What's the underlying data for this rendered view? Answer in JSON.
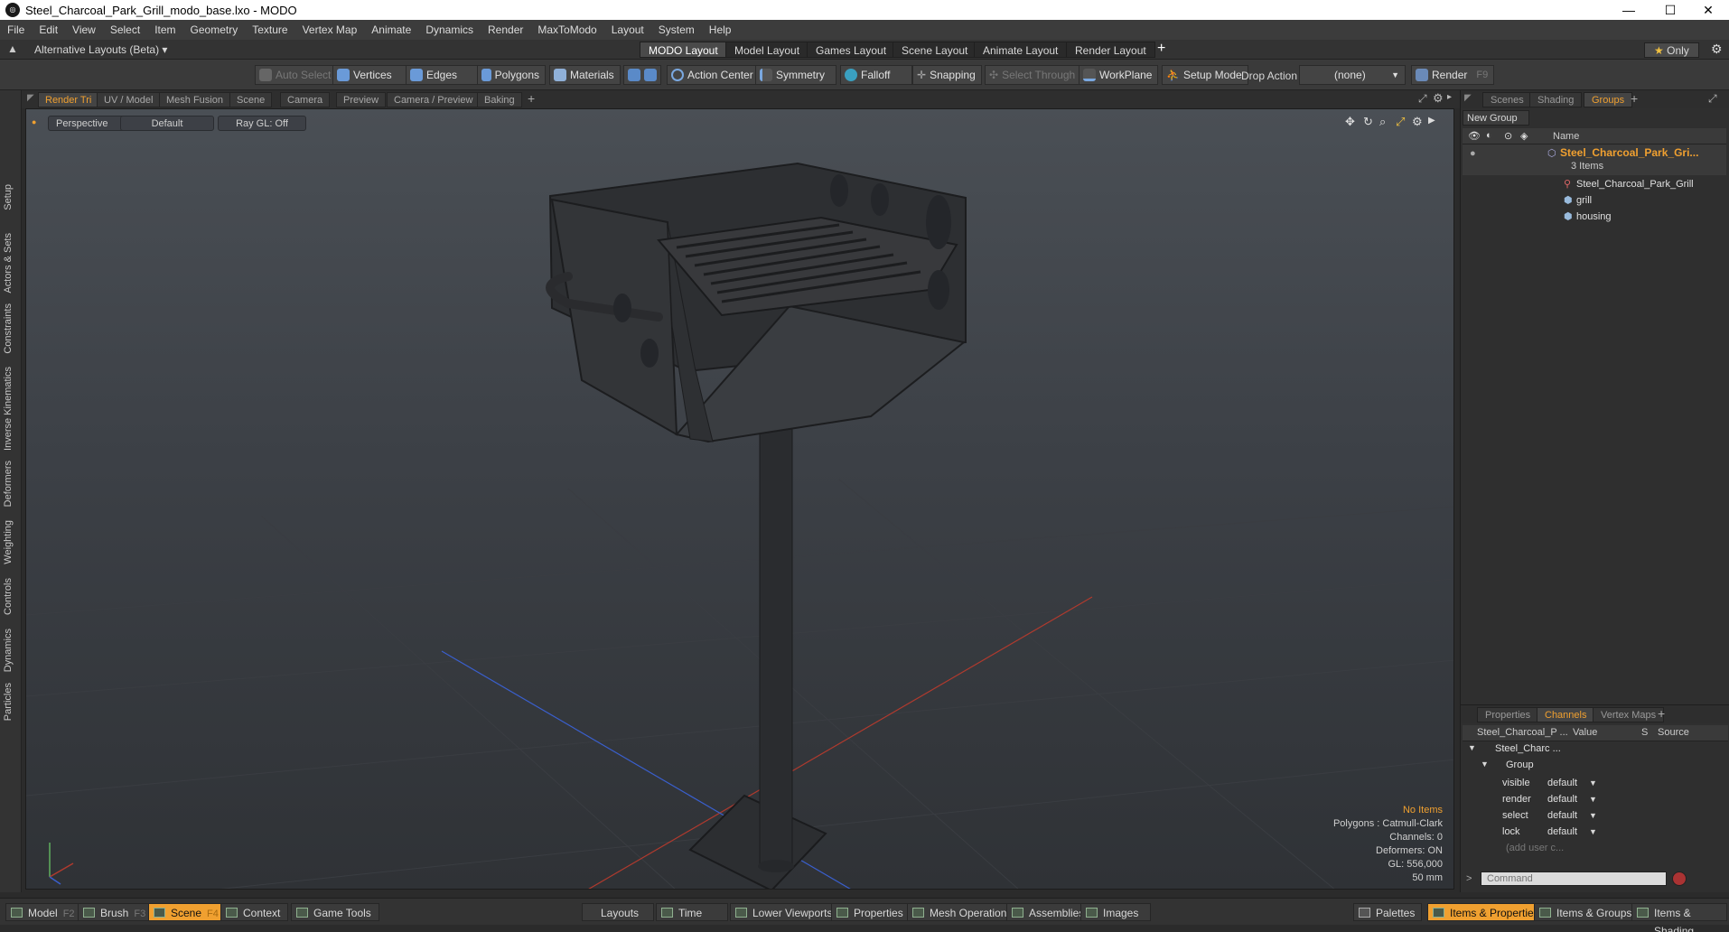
{
  "window": {
    "title": "Steel_Charcoal_Park_Grill_modo_base.lxo - MODO",
    "app_icon": "modo-logo-icon"
  },
  "menu": [
    "File",
    "Edit",
    "View",
    "Select",
    "Item",
    "Geometry",
    "Texture",
    "Vertex Map",
    "Animate",
    "Dynamics",
    "Render",
    "MaxToModo",
    "Layout",
    "System",
    "Help"
  ],
  "layoutbar": {
    "alt_layouts": "Alternative Layouts (Beta)",
    "tabs": [
      "MODO Layout",
      "Model Layout",
      "Games Layout",
      "Scene Layout",
      "Animate Layout",
      "Render Layout"
    ],
    "only_label": "Only"
  },
  "toolbar": {
    "auto_select": "Auto Select",
    "vertices": "Vertices",
    "edges": "Edges",
    "polygons": "Polygons",
    "materials": "Materials",
    "action_center": "Action Center",
    "symmetry": "Symmetry",
    "falloff": "Falloff",
    "snapping": "Snapping",
    "select_through": "Select Through",
    "workplane": "WorkPlane",
    "setup_mode": "Setup Mode",
    "drop_action": "Drop Action",
    "drop_value": "(none)",
    "render": "Render",
    "render_key": "F9"
  },
  "left_tabs": [
    "Setup",
    "Actors & Sets",
    "Constraints",
    "Inverse Kinematics",
    "Deformers",
    "Weighting",
    "Controls",
    "Dynamics",
    "Particles"
  ],
  "viewport_tabs": [
    "Render Tri",
    "UV / Model",
    "Mesh Fusion",
    "Scene",
    "Camera",
    "Preview",
    "Camera / Preview",
    "Baking"
  ],
  "viewport": {
    "view": "Perspective",
    "shading": "Default",
    "raygl": "Ray GL: Off",
    "info": {
      "no_items": "No Items",
      "polygons": "Polygons : Catmull-Clark",
      "channels": "Channels: 0",
      "deformers": "Deformers: ON",
      "gl": "GL: 556,000",
      "focal": "50 mm"
    }
  },
  "right_top": {
    "tabs": [
      "Scenes",
      "Shading",
      "Groups"
    ],
    "new_group": "New Group",
    "name_header": "Name",
    "group_name": "Steel_Charcoal_Park_Gri...",
    "group_count": "3 Items",
    "children": [
      "Steel_Charcoal_Park_Grill",
      "grill",
      "housing"
    ]
  },
  "right_bottom": {
    "tabs": [
      "Properties",
      "Channels",
      "Vertex Maps"
    ],
    "headers": {
      "name": "Steel_Charcoal_P ...",
      "value": "Value",
      "s": "S",
      "source": "Source"
    },
    "item": "Steel_Charc ...",
    "group": "Group",
    "channels": [
      {
        "name": "visible",
        "value": "default"
      },
      {
        "name": "render",
        "value": "default"
      },
      {
        "name": "select",
        "value": "default"
      },
      {
        "name": "lock",
        "value": "default"
      }
    ],
    "add_user": "(add user c...",
    "command_placeholder": "Command"
  },
  "bottombar": {
    "model": "Model",
    "model_key": "F2",
    "brush": "Brush",
    "brush_key": "F3",
    "scene": "Scene",
    "scene_key": "F4",
    "context": "Context",
    "game_tools": "Game Tools",
    "layouts": "Layouts",
    "time": "Time",
    "lower_viewports": "Lower Viewports",
    "properties": "Properties",
    "mesh_operations": "Mesh Operations",
    "assemblies": "Assemblies",
    "images": "Images",
    "palettes": "Palettes",
    "items_properties": "Items & Properties",
    "items_groups": "Items & Groups",
    "items_shading": "Items & Shading"
  },
  "colors": {
    "accent": "#f0a030",
    "viewport_top": "#4a4f55",
    "viewport_bottom": "#2f3236",
    "axis_x": "#c0392b",
    "axis_z": "#3a5fcd"
  }
}
